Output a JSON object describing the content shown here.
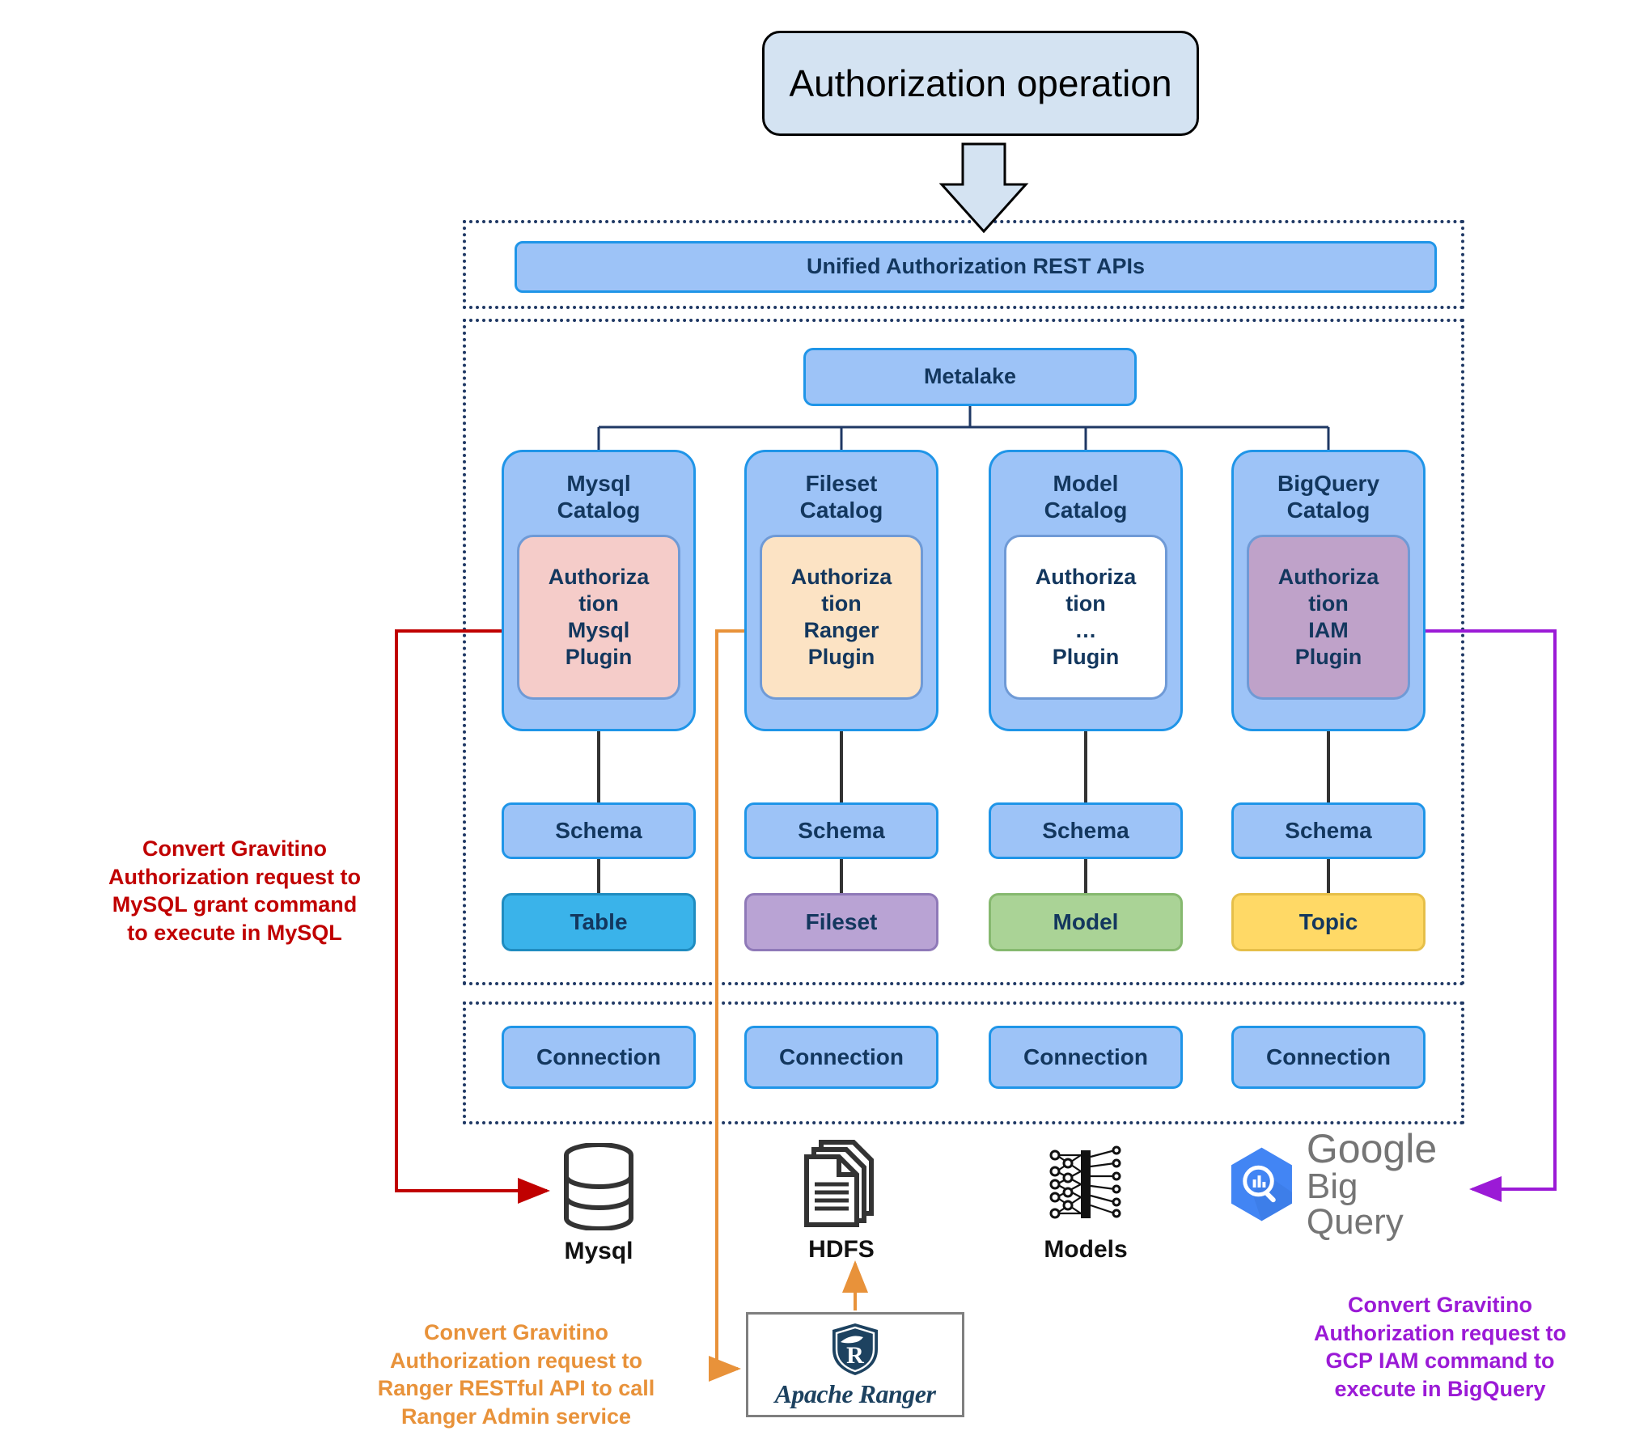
{
  "diagram": {
    "title": "Authorization operation",
    "top_operation": "Authorization operation",
    "api_bar": "Unified Authorization REST APIs",
    "metalake": "Metalake",
    "catalogs": [
      {
        "title": "Mysql\nCatalog",
        "title_line1": "Mysql",
        "title_line2": "Catalog",
        "plugin": "Authoriza tion Mysql Plugin",
        "plugin_lines": [
          "Authoriza",
          "tion",
          "Mysql",
          "Plugin"
        ],
        "plugin_fill": "#f5ccc9",
        "schema": "Schema",
        "entity": "Table",
        "entity_fill": "#3ab3ea",
        "entity_stroke": "#1f8cc0",
        "connection": "Connection",
        "source_label": "Mysql",
        "source_icon": "database-cylinder-icon"
      },
      {
        "title_line1": "Fileset",
        "title_line2": "Catalog",
        "plugin_lines": [
          "Authoriza",
          "tion",
          "Ranger",
          "Plugin"
        ],
        "plugin_fill": "#fce3c4",
        "schema": "Schema",
        "entity": "Fileset",
        "entity_fill": "#b9a3d4",
        "entity_stroke": "#8f79b8",
        "connection": "Connection",
        "source_label": "HDFS",
        "source_icon": "documents-stack-icon"
      },
      {
        "title_line1": "Model",
        "title_line2": "Catalog",
        "plugin_lines": [
          "Authoriza",
          "tion",
          "…",
          "Plugin"
        ],
        "plugin_fill": "#ffffff",
        "schema": "Schema",
        "entity": "Model",
        "entity_fill": "#aad396",
        "entity_stroke": "#86b96f",
        "connection": "Connection",
        "source_label": "Models",
        "source_icon": "neural-network-icon"
      },
      {
        "title_line1": "BigQuery",
        "title_line2": "Catalog",
        "plugin_lines": [
          "Authoriza",
          "tion",
          "IAM",
          "Plugin"
        ],
        "plugin_fill": "#bfa2c9",
        "schema": "Schema",
        "entity": "Topic",
        "entity_fill": "#ffd966",
        "entity_stroke": "#e6bf49",
        "connection": "Connection",
        "source_label": "",
        "source_icon": "google-bigquery-logo"
      }
    ],
    "bigquery_logo": {
      "line1": "Google",
      "line2": "Big Query"
    },
    "ranger": {
      "label": "Apache Ranger",
      "icon": "ranger-shield-logo"
    },
    "annotations": {
      "red": "Convert Gravitino Authorization request  to MySQL grant command to execute in MySQL",
      "red_lines": [
        "Convert Gravitino",
        "Authorization request  to",
        "MySQL grant command",
        "to execute in MySQL"
      ],
      "orange_lines": [
        "Convert Gravitino",
        "Authorization request  to",
        "Ranger RESTful API to call",
        "Ranger Admin service"
      ],
      "purple_lines": [
        "Convert Gravitino",
        "Authorization request  to",
        "GCP IAM command to",
        "execute in BigQuery"
      ]
    },
    "colors": {
      "red": "#c00000",
      "orange": "#e8923a",
      "purple": "#9b1ad6",
      "box_blue_fill": "#9dc3f7",
      "box_blue_stroke": "#1f95e8",
      "dotted_border": "#1f3864",
      "top_box_fill": "#d4e3f2",
      "text_navy": "#13375e"
    }
  }
}
